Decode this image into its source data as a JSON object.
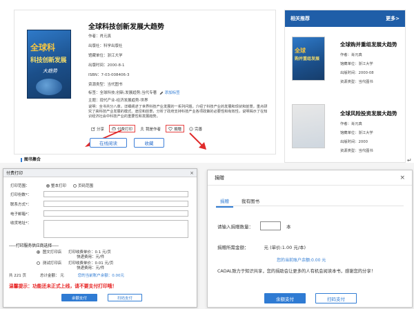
{
  "book": {
    "title": "全球科技创新发展大趋势",
    "cover_text": [
      "全球科",
      "科技创新发展",
      "大趋势"
    ],
    "author": "作者：肖元真",
    "publisher": "出版社：科学出版社",
    "holding": "馆藏单位：浙江大学",
    "pubtime": "出版时间：2000-8-1",
    "isbn": "ISBN：7-03-008406-3",
    "resource": "资源类型：当代图书",
    "tags_label": "标签：",
    "tags": "全球科技;创新;发展趋势;当代专著",
    "add_tag": "添加标签",
    "subject": "主题：现代产业-经济发展趋势-世界",
    "description": "说明：全书共分八章，详细阐述了世界科技产业发展的一系列问题，介绍了科技产业的发展和现状和前景，重点研究了高科技产业发展的模式、途径和前景，分析了政府支持科技产业各项政策的必要性和有效性，说明揭示了在知识经济社会中科技产业的重要性和发展趋势。",
    "actions": [
      "分享",
      "付费打印",
      "我是作者",
      "捐赠",
      "完善"
    ],
    "read_online": "在线阅读",
    "favorite": "收藏",
    "section": "图书集合"
  },
  "recommend": {
    "title": "相关推荐",
    "more": "更多>",
    "items": [
      {
        "title": "全球购并重组发展大趋势",
        "cover_line1": "全球",
        "cover_line2": "购并重组发展",
        "author": "作者：肖元真",
        "holding": "馆藏单位：浙江大学",
        "pubtime": "出版时间：2000-08",
        "resource": "资源类型：当代图书"
      },
      {
        "title": "全球风险投资发展大趋势",
        "author": "作者：肖元真",
        "holding": "馆藏单位：浙江大学",
        "pubtime": "出版时间：2000",
        "resource": "资源类型：当代图书"
      }
    ]
  },
  "print_dialog": {
    "title": "付费打印",
    "close": "×",
    "range_label": "打印范围：",
    "range_all": "整本打印",
    "range_pages": "页码范围",
    "copies_label": "打印份数*：",
    "contact_label": "联系方式*：",
    "email_label": "电子邮箱*：",
    "address_label": "收货地址*：",
    "supplier_title": "-----打印服务供应商选择-----",
    "suppliers": [
      {
        "name": "图文打印店",
        "fee": "打印收费单价：0.1 元/页",
        "ship": "快递费用：元/件"
      },
      {
        "name": "测试打印店",
        "fee": "打印收费单价：0.01 元/页",
        "ship": "快递费用：元/件"
      }
    ],
    "pages": "共 221 页",
    "total": "总计金额： 元",
    "balance": "您的当前账户余额：0.00元",
    "warning": "温馨提示：功能还未正式上线，请不要支付打印哦！",
    "pay_label": "余额支付",
    "scan_label": "扫码支付"
  },
  "donate_dialog": {
    "title": "捐赠",
    "close": "×",
    "tab_donate": "捐赠",
    "tab_my": "我有图书",
    "qty_label": "请输入捐赠数量：",
    "qty_unit": "本",
    "amount_label": "捐赠所需金额：",
    "amount_value": "元 (单价:1.00 元/本)",
    "balance": "您的当前账户余额:0.00 元",
    "note": "CADAL致力于知识共享，您的捐助会让更多的人有机会阅读本书，感谢您的分享！",
    "pay_label": "余额支付",
    "scan_label": "扫码支付"
  },
  "colors": {
    "accent": "#2f7bd3",
    "header": "#1f5ea8",
    "warn": "#e61e1e"
  }
}
